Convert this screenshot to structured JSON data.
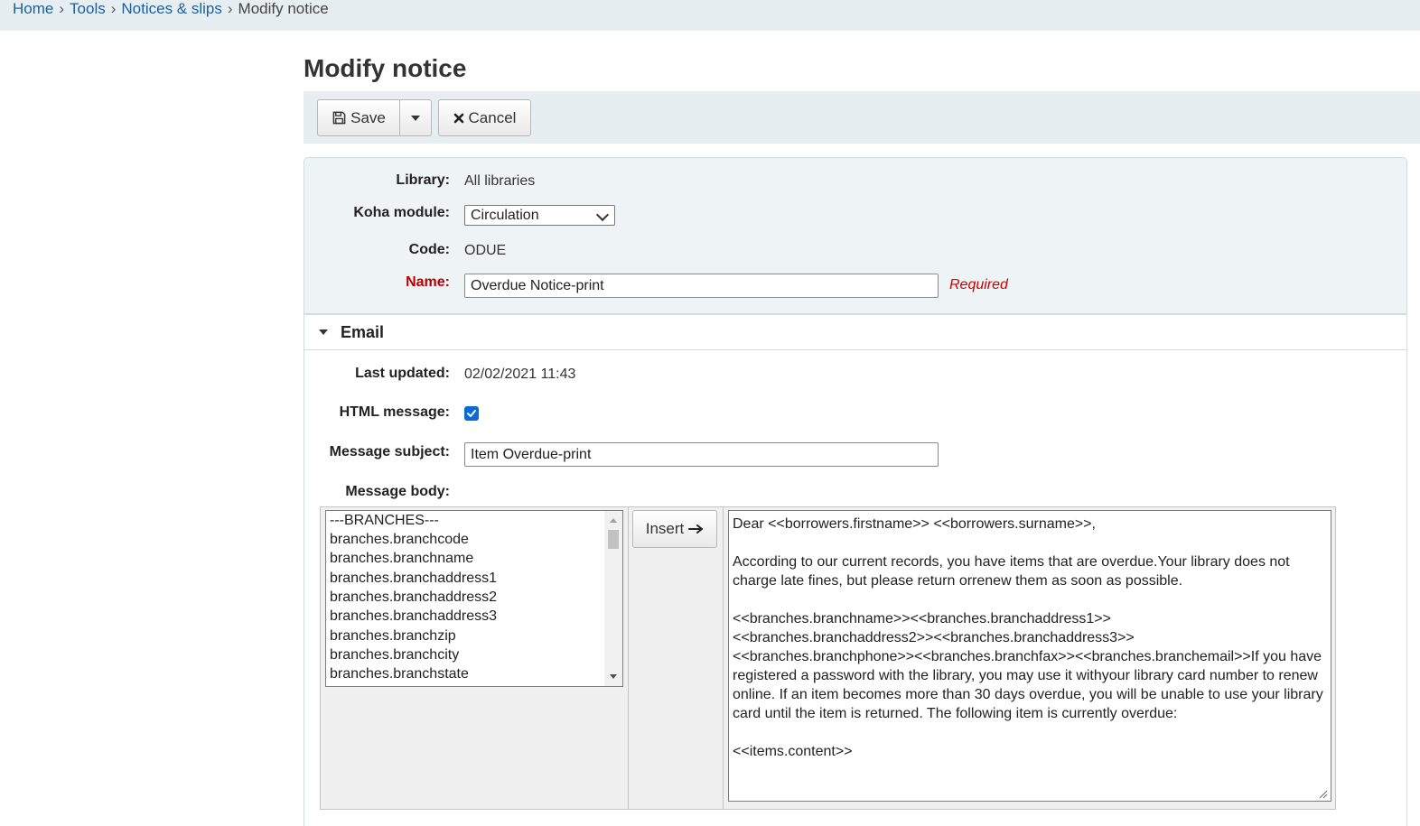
{
  "breadcrumb": {
    "home": "Home",
    "tools": "Tools",
    "notices": "Notices & slips",
    "current": "Modify notice",
    "separator": "›"
  },
  "page": {
    "title": "Modify notice"
  },
  "toolbar": {
    "save_label": "Save",
    "cancel_label": "Cancel"
  },
  "form": {
    "library_label": "Library:",
    "library_value": "All libraries",
    "module_label": "Koha module:",
    "module_selected": "Circulation",
    "code_label": "Code:",
    "code_value": "ODUE",
    "name_label": "Name:",
    "name_value": "Overdue Notice-print",
    "required_note": "Required"
  },
  "email": {
    "section_title": "Email",
    "last_updated_label": "Last updated:",
    "last_updated_value": "02/02/2021 11:43",
    "html_label": "HTML message:",
    "html_checked": true,
    "subject_label": "Message subject:",
    "subject_value": "Item Overdue-print",
    "body_label": "Message body:",
    "insert_label": "Insert",
    "fields": [
      "---BRANCHES---",
      "branches.branchcode",
      "branches.branchname",
      "branches.branchaddress1",
      "branches.branchaddress2",
      "branches.branchaddress3",
      "branches.branchzip",
      "branches.branchcity",
      "branches.branchstate"
    ],
    "body_text": "Dear <<borrowers.firstname>> <<borrowers.surname>>,\n\nAccording to our current records, you have items that are overdue.Your library does not charge late fines, but please return orrenew them as soon as possible.\n\n<<branches.branchname>><<branches.branchaddress1>>\n<<branches.branchaddress2>><<branches.branchaddress3>>\n<<branches.branchphone>><<branches.branchfax>><<branches.branchemail>>If you have registered a password with the library, you may use it withyour library card number to renew online. If an item becomes more than 30 days overdue, you will be unable to use your library card until the item is returned. The following item is currently overdue:\n\n<<items.content>>"
  },
  "colors": {
    "link": "#1f5f9e",
    "required": "#c00000",
    "checkbox": "#0b6bd3",
    "bar": "#e6eef2"
  }
}
